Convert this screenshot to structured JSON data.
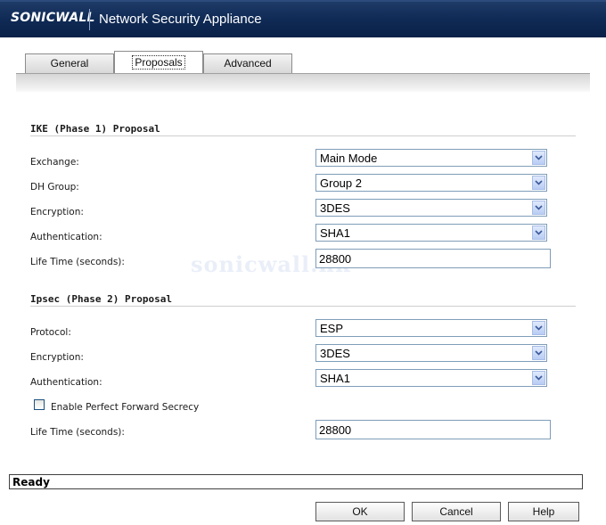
{
  "header": {
    "logo_text": "SONICWALL",
    "title": "Network Security Appliance"
  },
  "tabs": [
    {
      "label": "General"
    },
    {
      "label": "Proposals",
      "active": true
    },
    {
      "label": "Advanced"
    }
  ],
  "ike": {
    "section_title": "IKE (Phase 1) Proposal",
    "exchange": {
      "label": "Exchange:",
      "value": "Main Mode"
    },
    "dh_group": {
      "label": "DH Group:",
      "value": "Group 2"
    },
    "encryption": {
      "label": "Encryption:",
      "value": "3DES"
    },
    "authentication": {
      "label": "Authentication:",
      "value": "SHA1"
    },
    "lifetime": {
      "label": "Life Time (seconds):",
      "value": "28800"
    }
  },
  "ipsec": {
    "section_title": "Ipsec (Phase 2) Proposal",
    "protocol": {
      "label": "Protocol:",
      "value": "ESP"
    },
    "encryption": {
      "label": "Encryption:",
      "value": "3DES"
    },
    "authentication": {
      "label": "Authentication:",
      "value": "SHA1"
    },
    "pfs": {
      "label": "Enable Perfect Forward Secrecy",
      "checked": false
    },
    "lifetime": {
      "label": "Life Time (seconds):",
      "value": "28800"
    }
  },
  "watermark": "sonicwall.hk",
  "status": {
    "text": "Ready"
  },
  "buttons": {
    "ok": "OK",
    "cancel": "Cancel",
    "help": "Help"
  },
  "colors": {
    "header_bg": "#0f2a55",
    "input_border": "#7f9db9",
    "dropdown_button": "#c8d8f6"
  }
}
